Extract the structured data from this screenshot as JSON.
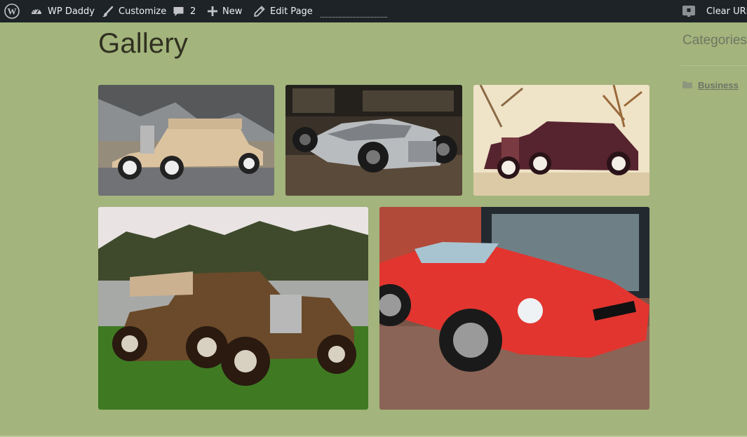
{
  "adminbar": {
    "wp_logo_icon": "wordpress-logo-icon",
    "site_name": "WP Daddy",
    "customize": "Customize",
    "comments_count": "2",
    "new": "New",
    "edit_page": "Edit Page",
    "clear_url": "Clear URL"
  },
  "page": {
    "title": "Gallery",
    "gallery": [
      {
        "subject": "beige vintage sedan",
        "color": "#d8c2a0"
      },
      {
        "subject": "silver concept race car",
        "color": "#a7abad"
      },
      {
        "subject": "maroon vintage convertible",
        "color": "#5e2a35"
      },
      {
        "subject": "brown vintage convertible on lawn",
        "color": "#6a4a2a"
      },
      {
        "subject": "red sports convertible",
        "color": "#e23a35"
      }
    ]
  },
  "sidebar": {
    "categories_title": "Categories",
    "categories": [
      {
        "label": "Business"
      }
    ]
  },
  "colors": {
    "page_background": "#a3b47c",
    "adminbar_background": "#1d2327"
  }
}
